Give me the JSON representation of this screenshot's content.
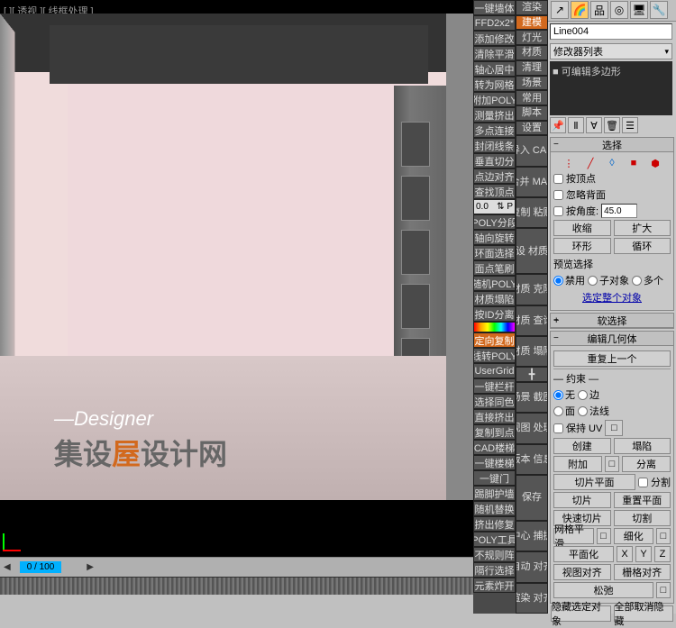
{
  "viewport_label": "[ ][ 透视 ][ 线框处理 ]",
  "watermark": {
    "designer": "—Designer",
    "title_pre": "集设",
    "title_o": "屋",
    "title_post": "设计网"
  },
  "timeline": {
    "frame": "0 / 100"
  },
  "col1": [
    "一键墙体",
    "FFD2x2*",
    "添加修改",
    "清除平滑",
    "轴心居中",
    "转为网格",
    "附加POLY",
    "测量挤出",
    "多点连接",
    "封闭线条",
    "垂直切分",
    "点边对齐",
    "查找顶点"
  ],
  "col1_spin": "0.0",
  "col1b": [
    "POLY分段",
    "轴向旋转",
    "环面选择",
    "面点笔刷",
    "随机POLY",
    "材质塌陷",
    "按ID分离"
  ],
  "col1c": [
    "定向复制",
    "线转POLY",
    "UserGrid",
    "一键栏杆",
    "选择同色",
    "直接挤出",
    "复制到点",
    "CAD楼梯",
    "一键楼梯",
    "一键门",
    "踢脚护墙",
    "随机替换",
    "挤出修复",
    "POLY工具",
    "不规则阵",
    "隔行选择",
    "元素炸开"
  ],
  "col2_top": [
    "渲染",
    "建模",
    "灯光",
    "材质",
    "清理",
    "场景",
    "常用",
    "脚本",
    "设置"
  ],
  "col2_mid": [
    "导入\nCAD",
    "合并\nMAX",
    "复制\n粘贴",
    "预设\n材质库",
    "材质\n克隆",
    "材质\n查询",
    "材质\n塌陷"
  ],
  "col2_sm": "╋",
  "col2_bot": [
    "场景\n截图",
    "视图\n处理",
    "版本\n信息",
    "保存",
    "中心\n捕捉",
    "自动\n对齐",
    "渲染\n对齐"
  ],
  "object_name": "Line004",
  "modifier_label": "修改器列表",
  "modifier_item": "■ 可编辑多边形",
  "sections": {
    "select": {
      "title": "选择",
      "by_vertex": "按顶点",
      "ignore_back": "忽略背面",
      "by_angle": "按角度:",
      "angle_val": "45.0",
      "btns": [
        "收缩",
        "扩大",
        "环形",
        "循环"
      ],
      "preview": "预览选择",
      "radios": [
        "禁用",
        "子对象",
        "多个"
      ],
      "whole": "选定整个对象"
    },
    "soft": {
      "title": "软选择"
    },
    "geom": {
      "title": "编辑几何体",
      "repeat": "重复上一个",
      "constraint": "约束",
      "c_radios": [
        "无",
        "边",
        "面",
        "法线"
      ],
      "preserve": "保持 UV",
      "btns1": [
        "创建",
        "塌陷"
      ],
      "attach": "附加",
      "detach": "分离",
      "slice_plane": "切片平面",
      "split": "分割",
      "btns2": [
        "快速切片",
        "切割"
      ],
      "mesh_smooth": "网格平滑",
      "tess": "细化",
      "planarize": "平面化",
      "align_view": "视图对齐",
      "align_grid": "栅格对齐",
      "relax": "松弛"
    }
  },
  "footer": {
    "hide_sel": "隐藏选定对象",
    "unhide_all": "全部取消隐藏"
  }
}
